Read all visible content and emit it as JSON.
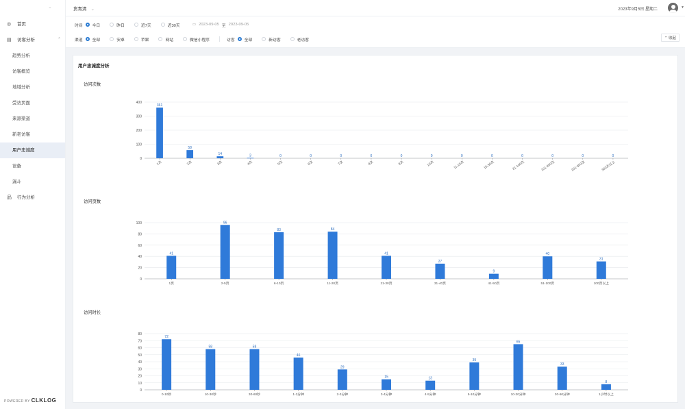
{
  "header": {
    "project": "货青清",
    "datetime": "2023年9月5日 星期二"
  },
  "sidebar": {
    "items": [
      {
        "label": "首页",
        "icon": "home-icon",
        "type": "top"
      },
      {
        "label": "访客分析",
        "icon": "bar-chart-icon",
        "type": "top",
        "expanded": true
      },
      {
        "label": "趋势分析",
        "type": "sub"
      },
      {
        "label": "访客概览",
        "type": "sub"
      },
      {
        "label": "地域分析",
        "type": "sub"
      },
      {
        "label": "受访页面",
        "type": "sub"
      },
      {
        "label": "来源渠道",
        "type": "sub"
      },
      {
        "label": "新老访客",
        "type": "sub"
      },
      {
        "label": "用户忠诚度",
        "type": "sub",
        "active": true
      },
      {
        "label": "设备",
        "type": "sub"
      },
      {
        "label": "漏斗",
        "type": "sub"
      },
      {
        "label": "行为分析",
        "icon": "sitemap-icon",
        "type": "top"
      }
    ],
    "powered_prefix": "POWERED BY",
    "powered_brand": "CLKLOG"
  },
  "filters": {
    "time_label": "时间",
    "time_options": [
      "今日",
      "昨日",
      "近7天",
      "近30天"
    ],
    "time_selected": 0,
    "date_start": "2023-09-05",
    "date_sep": "至",
    "date_end": "2023-09-05",
    "channel_label": "渠道",
    "channel_options": [
      "全部",
      "安卓",
      "苹果",
      "网站",
      "微信小程序"
    ],
    "channel_selected": 0,
    "visitor_label": "访客",
    "visitor_options": [
      "全部",
      "新访客",
      "老访客"
    ],
    "visitor_selected": 0,
    "collapse_label": "收起"
  },
  "card": {
    "title": "用户忠诚度分析"
  },
  "colors": {
    "bar": "#2f7ad9",
    "label": "#2f6fbf",
    "active_bg": "#e9eef6",
    "radio": "#2b7cd3"
  },
  "chart_data": [
    {
      "type": "bar",
      "title": "访问次数",
      "categories": [
        "1次",
        "2次",
        "3次",
        "4次",
        "5次",
        "6次",
        "7次",
        "8次",
        "9次",
        "10次",
        "11-15次",
        "16-30次",
        "31-100次",
        "101-200次",
        "201-300次",
        "300次以上"
      ],
      "values": [
        361,
        58,
        14,
        3,
        0,
        0,
        0,
        0,
        0,
        0,
        0,
        0,
        0,
        0,
        0,
        0
      ],
      "ylim": [
        0,
        400
      ],
      "yticks": [
        0,
        100,
        200,
        300,
        400
      ],
      "rotated_labels": true
    },
    {
      "type": "bar",
      "title": "访问页数",
      "categories": [
        "1页",
        "2-5页",
        "6-10页",
        "11-20页",
        "21-30页",
        "31-40页",
        "41-50页",
        "51-100页",
        "100页以上"
      ],
      "values": [
        41,
        96,
        83,
        84,
        41,
        27,
        9,
        40,
        31
      ],
      "ylim": [
        0,
        100
      ],
      "yticks": [
        0,
        20,
        40,
        60,
        80,
        100
      ],
      "rotated_labels": false
    },
    {
      "type": "bar",
      "title": "访问时长",
      "categories": [
        "0-10秒",
        "10-30秒",
        "30-60秒",
        "1-2分钟",
        "2-3分钟",
        "3-4分钟",
        "4-5分钟",
        "5-10分钟",
        "10-30分钟",
        "30-60分钟",
        "1小时以上"
      ],
      "values": [
        72,
        58,
        58,
        46,
        29,
        15,
        13,
        39,
        65,
        33,
        8
      ],
      "ylim": [
        0,
        80
      ],
      "yticks": [
        0,
        10,
        20,
        30,
        40,
        50,
        60,
        70,
        80
      ],
      "rotated_labels": false
    }
  ]
}
